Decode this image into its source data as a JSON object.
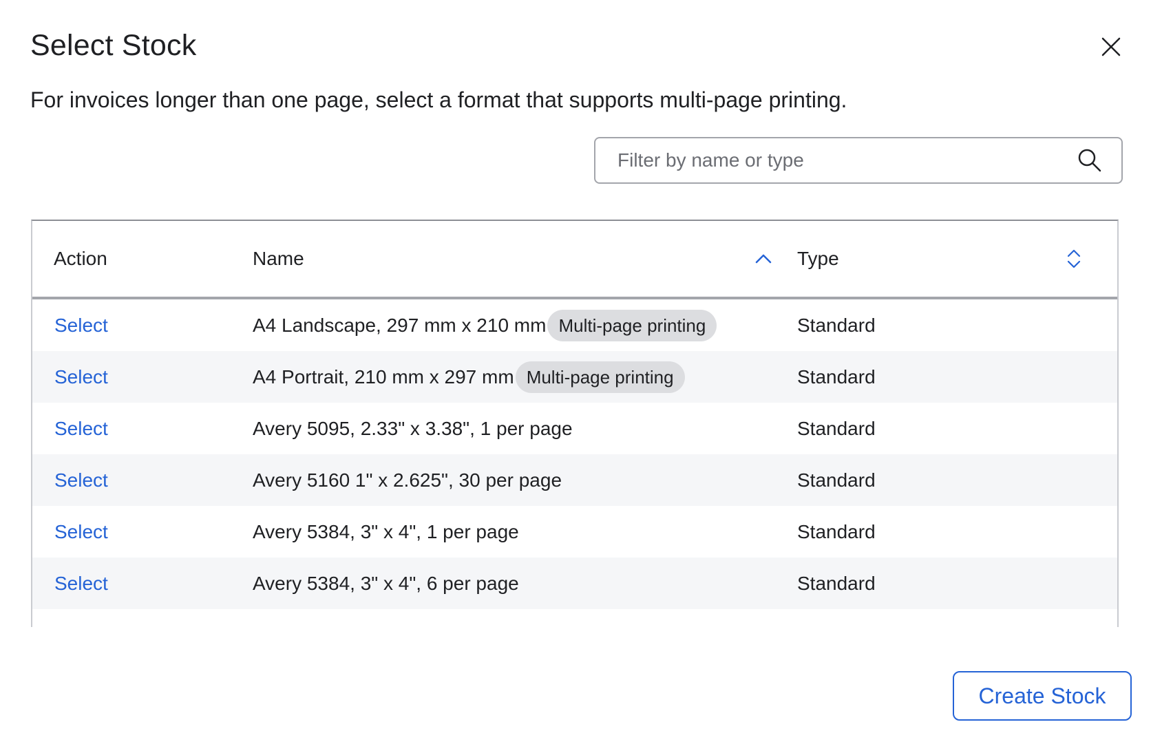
{
  "dialog": {
    "title": "Select Stock",
    "description": "For invoices longer than one page, select a format that supports multi-page printing.",
    "close_icon": "close-icon"
  },
  "search": {
    "placeholder": "Filter by name or type",
    "value": "",
    "icon": "search-icon"
  },
  "table": {
    "columns": {
      "action": "Action",
      "name": "Name",
      "type": "Type"
    },
    "sort": {
      "name": "ascending",
      "type": "unsorted"
    },
    "rows": [
      {
        "action": "Select",
        "name": "A4 Landscape, 297 mm x 210 mm",
        "badge": "Multi-page printing",
        "type": "Standard"
      },
      {
        "action": "Select",
        "name": "A4 Portrait, 210 mm x 297 mm",
        "badge": "Multi-page printing",
        "type": "Standard"
      },
      {
        "action": "Select",
        "name": "Avery 5095, 2.33\" x 3.38\", 1 per page",
        "badge": "",
        "type": "Standard"
      },
      {
        "action": "Select",
        "name": "Avery 5160 1\" x 2.625\", 30 per page",
        "badge": "",
        "type": "Standard"
      },
      {
        "action": "Select",
        "name": "Avery 5384, 3\" x 4\", 1 per page",
        "badge": "",
        "type": "Standard"
      },
      {
        "action": "Select",
        "name": "Avery 5384, 3\" x 4\", 6 per page",
        "badge": "",
        "type": "Standard"
      }
    ]
  },
  "footer": {
    "create_label": "Create Stock"
  },
  "colors": {
    "accent": "#2563d6",
    "text": "#1f2023",
    "row_alt": "#f5f6f8",
    "badge_bg": "#dcdde0"
  }
}
